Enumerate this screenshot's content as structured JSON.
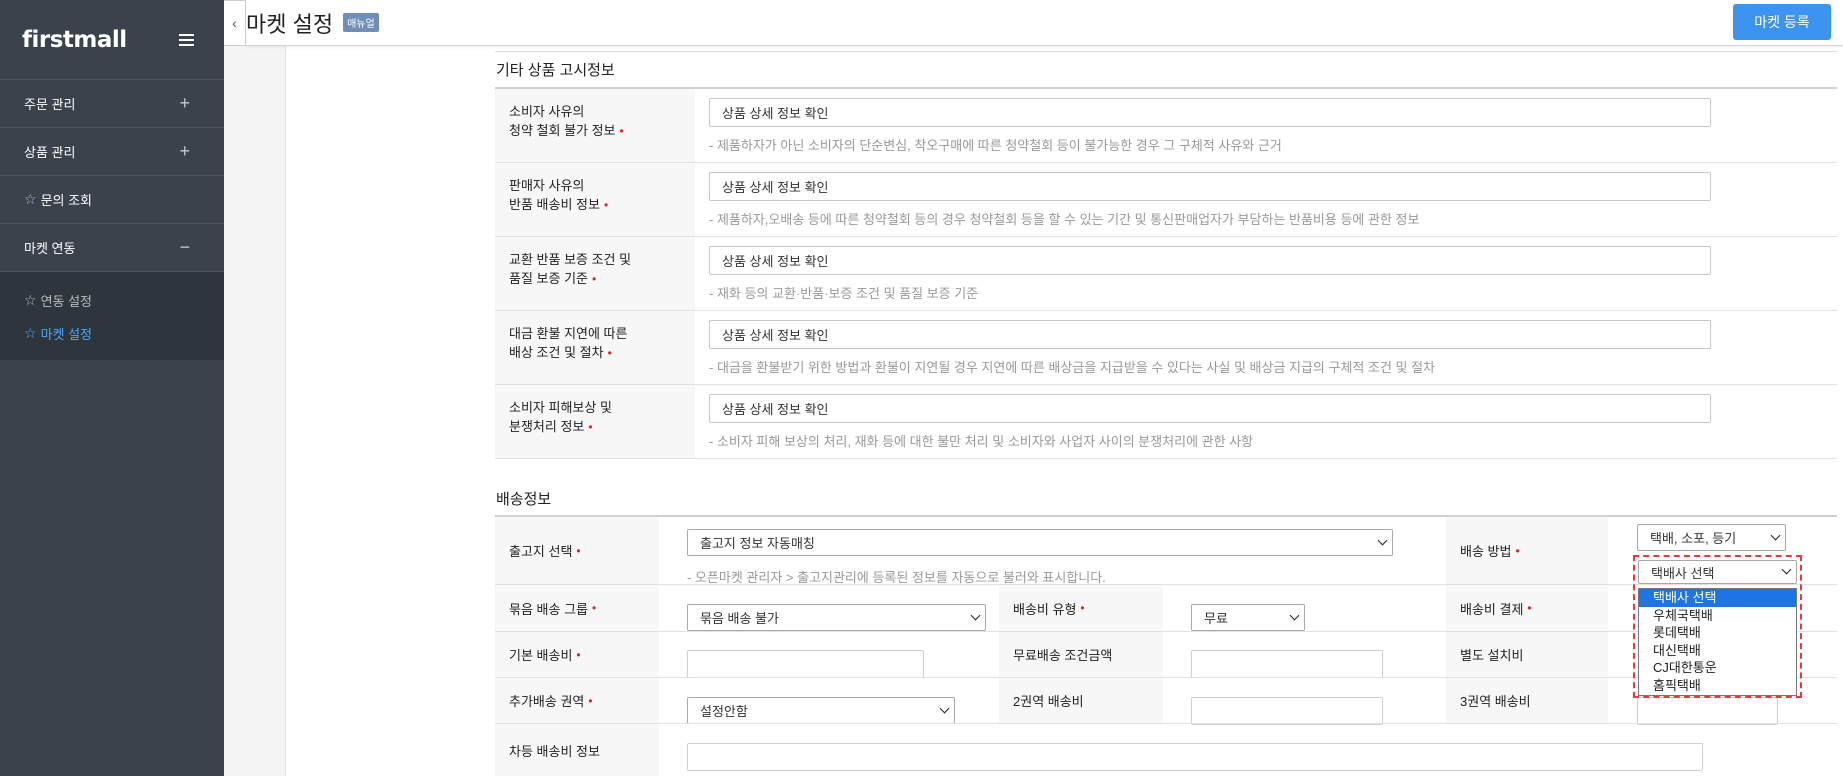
{
  "sidebar": {
    "logo": "firstmall",
    "menu": [
      {
        "label": "주문 관리",
        "toggle": "+"
      },
      {
        "label": "상품 관리",
        "toggle": "+"
      },
      {
        "label": "문의 조회",
        "toggle": ""
      },
      {
        "label": "마켓 연동",
        "toggle": "−"
      }
    ],
    "submenu": [
      {
        "label": "연동 설정"
      },
      {
        "label": "마켓 설정"
      }
    ]
  },
  "header": {
    "collapse_icon": "‹",
    "title": "마켓 설정",
    "manual_badge": "매뉴얼",
    "register_button": "마켓 등록"
  },
  "notice_section": {
    "title": "기타 상품 고시정보",
    "rows": [
      {
        "label_line1": "소비자 사유의",
        "label_line2": "청약 철회 불가 정보",
        "value": "상품 상세 정보 확인",
        "hint": "- 제품하자가 아닌 소비자의 단순변심, 착오구매에 따른 청약철회 등이 불가능한 경우 그 구체적 사유와 근거"
      },
      {
        "label_line1": "판매자 사유의",
        "label_line2": "반품 배송비 정보",
        "value": "상품 상세 정보 확인",
        "hint": "- 제품하자,오배송 등에 따른 청약철회 등의 경우 청약철회 등을 할 수 있는 기간 및 통신판매업자가 부담하는 반품비용 등에 관한 정보"
      },
      {
        "label_line1": "교환 반품 보증 조건 및",
        "label_line2": "품질 보증 기준",
        "value": "상품 상세 정보 확인",
        "hint": "- 재화 등의 교환·반품·보증 조건 및 품질 보증 기준"
      },
      {
        "label_line1": "대금 환불 지연에 따른",
        "label_line2": "배상 조건 및 절차",
        "value": "상품 상세 정보 확인",
        "hint": "- 대금을 환불받기 위한 방법과 환불이 지연될 경우 지연에 따른 배상금을 지급받을 수 있다는 사실 및 배상금 지급의 구체적 조건 및 절차"
      },
      {
        "label_line1": "소비자 피해보상 및",
        "label_line2": "분쟁처리 정보",
        "value": "상품 상세 정보 확인",
        "hint": "- 소비자 피해 보상의 처리, 재화 등에 대한 불만 처리 및 소비자와 사업자 사이의 분쟁처리에 관한 사항"
      }
    ]
  },
  "shipping_section": {
    "title": "배송정보",
    "origin_label": "출고지 선택",
    "origin_value": "출고지 정보 자동매칭",
    "origin_hint": "- 오픈마켓 관리자 > 출고지관리에 등록된 정보를 자동으로 불러와 표시합니다.",
    "method_label": "배송 방법",
    "method_value": "택배, 소포, 등기",
    "courier_value": "택배사 선택",
    "courier_options": [
      "택배사 선택",
      "우체국택배",
      "롯데택배",
      "대신택배",
      "CJ대한통운",
      "홈픽택배"
    ],
    "group_label": "묶음 배송 그룹",
    "group_value": "묶음 배송 불가",
    "fee_type_label": "배송비 유형",
    "fee_type_value": "무료",
    "fee_payment_label": "배송비 결제",
    "base_fee_label": "기본 배송비",
    "free_threshold_label": "무료배송 조건금액",
    "install_fee_label": "별도 설치비",
    "extra_zone_label": "추가배송 권역",
    "extra_zone_value": "설정안함",
    "zone2_label": "2권역 배송비",
    "zone3_label": "3권역 배송비",
    "diff_fee_label": "차등 배송비 정보",
    "required_mark": "•"
  },
  "colors": {
    "sidebar_bg": "#3b424b",
    "accent": "#3c94f0",
    "required": "#e21d1d",
    "active_menu": "#4aa8ff"
  }
}
